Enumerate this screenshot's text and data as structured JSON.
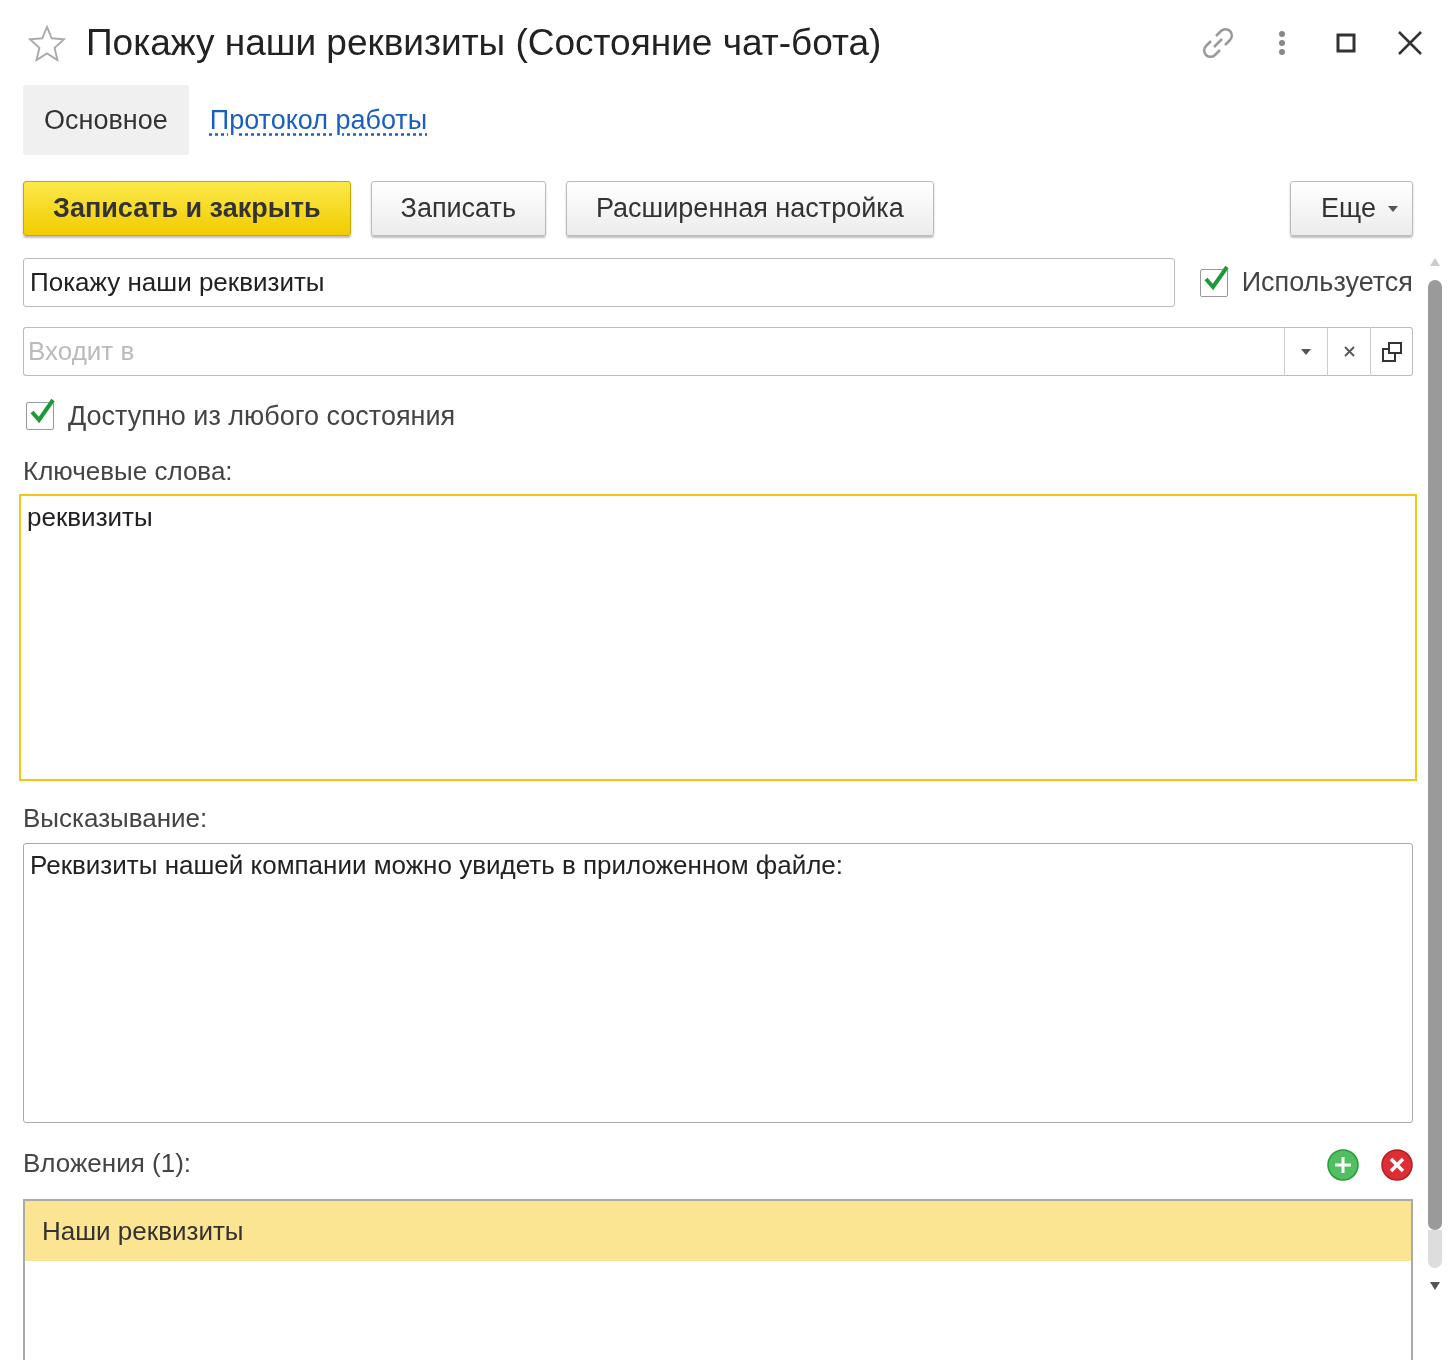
{
  "window": {
    "title": "Покажу наши реквизиты (Состояние чат-бота)"
  },
  "tabs": [
    {
      "label": "Основное",
      "selected": true
    },
    {
      "label": "Протокол работы",
      "selected": false
    }
  ],
  "toolbar": {
    "buttons": [
      {
        "label": "Записать и закрыть",
        "kind": "primary"
      },
      {
        "label": "Записать",
        "kind": "normal"
      },
      {
        "label": "Расширенная настройка",
        "kind": "normal"
      }
    ],
    "more": {
      "label": "Еще"
    }
  },
  "name_field": {
    "value": "Покажу наши реквизиты"
  },
  "used": {
    "label": "Используется",
    "checked": true
  },
  "parent_field": {
    "placeholder": "Входит в"
  },
  "any_state": {
    "label": "Доступно из любого состояния",
    "checked": true
  },
  "keywords": {
    "label": "Ключевые слова:",
    "value": "реквизиты",
    "focused": true
  },
  "utterance": {
    "label": "Высказывание:",
    "value": "Реквизиты нашей компании можно увидеть в приложенном файле:",
    "focused": false
  },
  "attachments": {
    "label": "Вложения (1):",
    "rows": [
      {
        "name": "Наши реквизиты",
        "selected": true
      }
    ]
  }
}
